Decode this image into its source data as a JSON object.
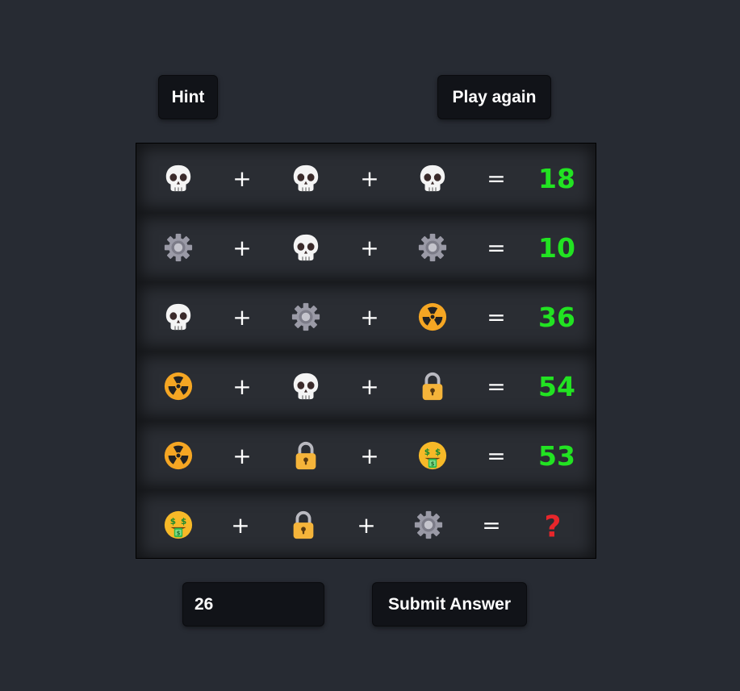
{
  "controls": {
    "hint_label": "Hint",
    "play_again_label": "Play again",
    "answer_value": "26",
    "submit_label": "Submit Answer"
  },
  "colors": {
    "background": "#272b33",
    "button": "#111318",
    "result_green": "#22e322",
    "question_red": "#e8262b"
  },
  "puzzle": {
    "rows": [
      {
        "items": [
          "skull-icon",
          "skull-icon",
          "skull-icon"
        ],
        "ops": [
          "+",
          "+"
        ],
        "equals": "=",
        "result": "18"
      },
      {
        "items": [
          "gear-icon",
          "skull-icon",
          "gear-icon"
        ],
        "ops": [
          "+",
          "+"
        ],
        "equals": "=",
        "result": "10"
      },
      {
        "items": [
          "skull-icon",
          "gear-icon",
          "radioactive-icon"
        ],
        "ops": [
          "+",
          "+"
        ],
        "equals": "=",
        "result": "36"
      },
      {
        "items": [
          "radioactive-icon",
          "skull-icon",
          "lock-icon"
        ],
        "ops": [
          "+",
          "+"
        ],
        "equals": "=",
        "result": "54"
      },
      {
        "items": [
          "radioactive-icon",
          "lock-icon",
          "money-mouth-face-icon"
        ],
        "ops": [
          "+",
          "+"
        ],
        "equals": "=",
        "result": "53"
      },
      {
        "items": [
          "money-mouth-face-icon",
          "lock-icon",
          "gear-icon"
        ],
        "ops": [
          "+",
          "+"
        ],
        "equals": "=",
        "result": "?"
      }
    ]
  }
}
